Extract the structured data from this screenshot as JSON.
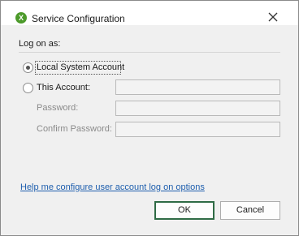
{
  "window": {
    "title": "Service Configuration",
    "app_icon_letter": "X",
    "close_symbol": "close-icon"
  },
  "logon": {
    "group_label": "Log on as:",
    "local_system_label": "Local System Account",
    "local_system_selected": true,
    "this_account_label": "This Account:",
    "this_account_selected": false,
    "account_value": "",
    "password_label": "Password:",
    "password_value": "",
    "confirm_password_label": "Confirm Password:",
    "confirm_password_value": ""
  },
  "help_link": "Help me configure user account log on options",
  "buttons": {
    "ok": "OK",
    "cancel": "Cancel"
  },
  "colors": {
    "accent_green": "#4c9a2a",
    "link_blue": "#1f5fae",
    "default_button_border": "#2f6b45"
  }
}
